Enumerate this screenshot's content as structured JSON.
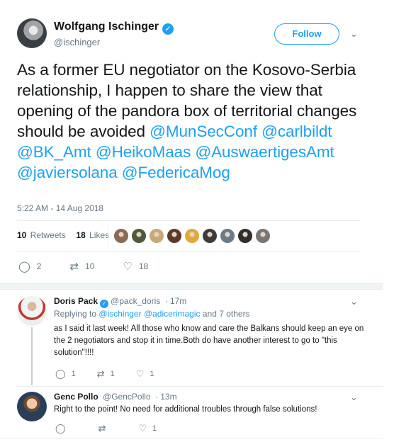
{
  "tweet": {
    "author_name": "Wolfgang Ischinger",
    "verified_glyph": "✓",
    "handle": "@ischinger",
    "follow_label": "Follow",
    "text_plain": "As a former EU negotiator on the Kosovo-Serbia relationship, I happen to share the view that opening of the pandora box of territorial changes should be avoided",
    "mentions": [
      "@MunSecConf",
      "@carlbildt",
      "@BK_Amt",
      "@HeikoMaas",
      "@AuswaertigesAmt",
      "@javiersolana",
      "@FedericaMog"
    ],
    "timestamp": "5:22 AM - 14 Aug 2018",
    "retweets_count": "10",
    "retweets_label": "Retweets",
    "likes_count": "18",
    "likes_label": "Likes",
    "likers_colors": [
      "#8a6a52",
      "#4d5a3c",
      "#c9a877",
      "#5b3a2a",
      "#e0a93a",
      "#3c3c3c",
      "#6b7b8a",
      "#2f2f2f",
      "#777777"
    ],
    "actions": {
      "replies": "2",
      "retweets": "10",
      "likes": "18"
    }
  },
  "replies": [
    {
      "name": "Doris Pack",
      "verified": true,
      "handle": "@pack_doris",
      "time": "· 17m",
      "replying_prefix": "Replying to",
      "replying_mentions": [
        "@ischinger",
        "@adicerimagic"
      ],
      "replying_suffix": "and 7 others",
      "text": "as I said it last week! All those who know and care the Balkans should keep an eye on the 2 negotiators and stop it in time.Both do have another interest to go to \"this solution\"!!!!",
      "actions": {
        "replies": "1",
        "retweets": "1",
        "likes": "1"
      }
    },
    {
      "name": "Genc Pollo",
      "verified": false,
      "handle": "@GencPollo",
      "time": "· 13m",
      "text": "Right to the point! No need for additional troubles through false solutions!",
      "actions": {
        "replies": "",
        "retweets": "",
        "likes": "1"
      }
    }
  ],
  "icons": {
    "chevron": "⌄",
    "reply": "◯",
    "retweet": "⇄",
    "like": "♡"
  },
  "colors": {
    "accent": "#1da1f2",
    "muted": "#657786",
    "text": "#14171a"
  }
}
